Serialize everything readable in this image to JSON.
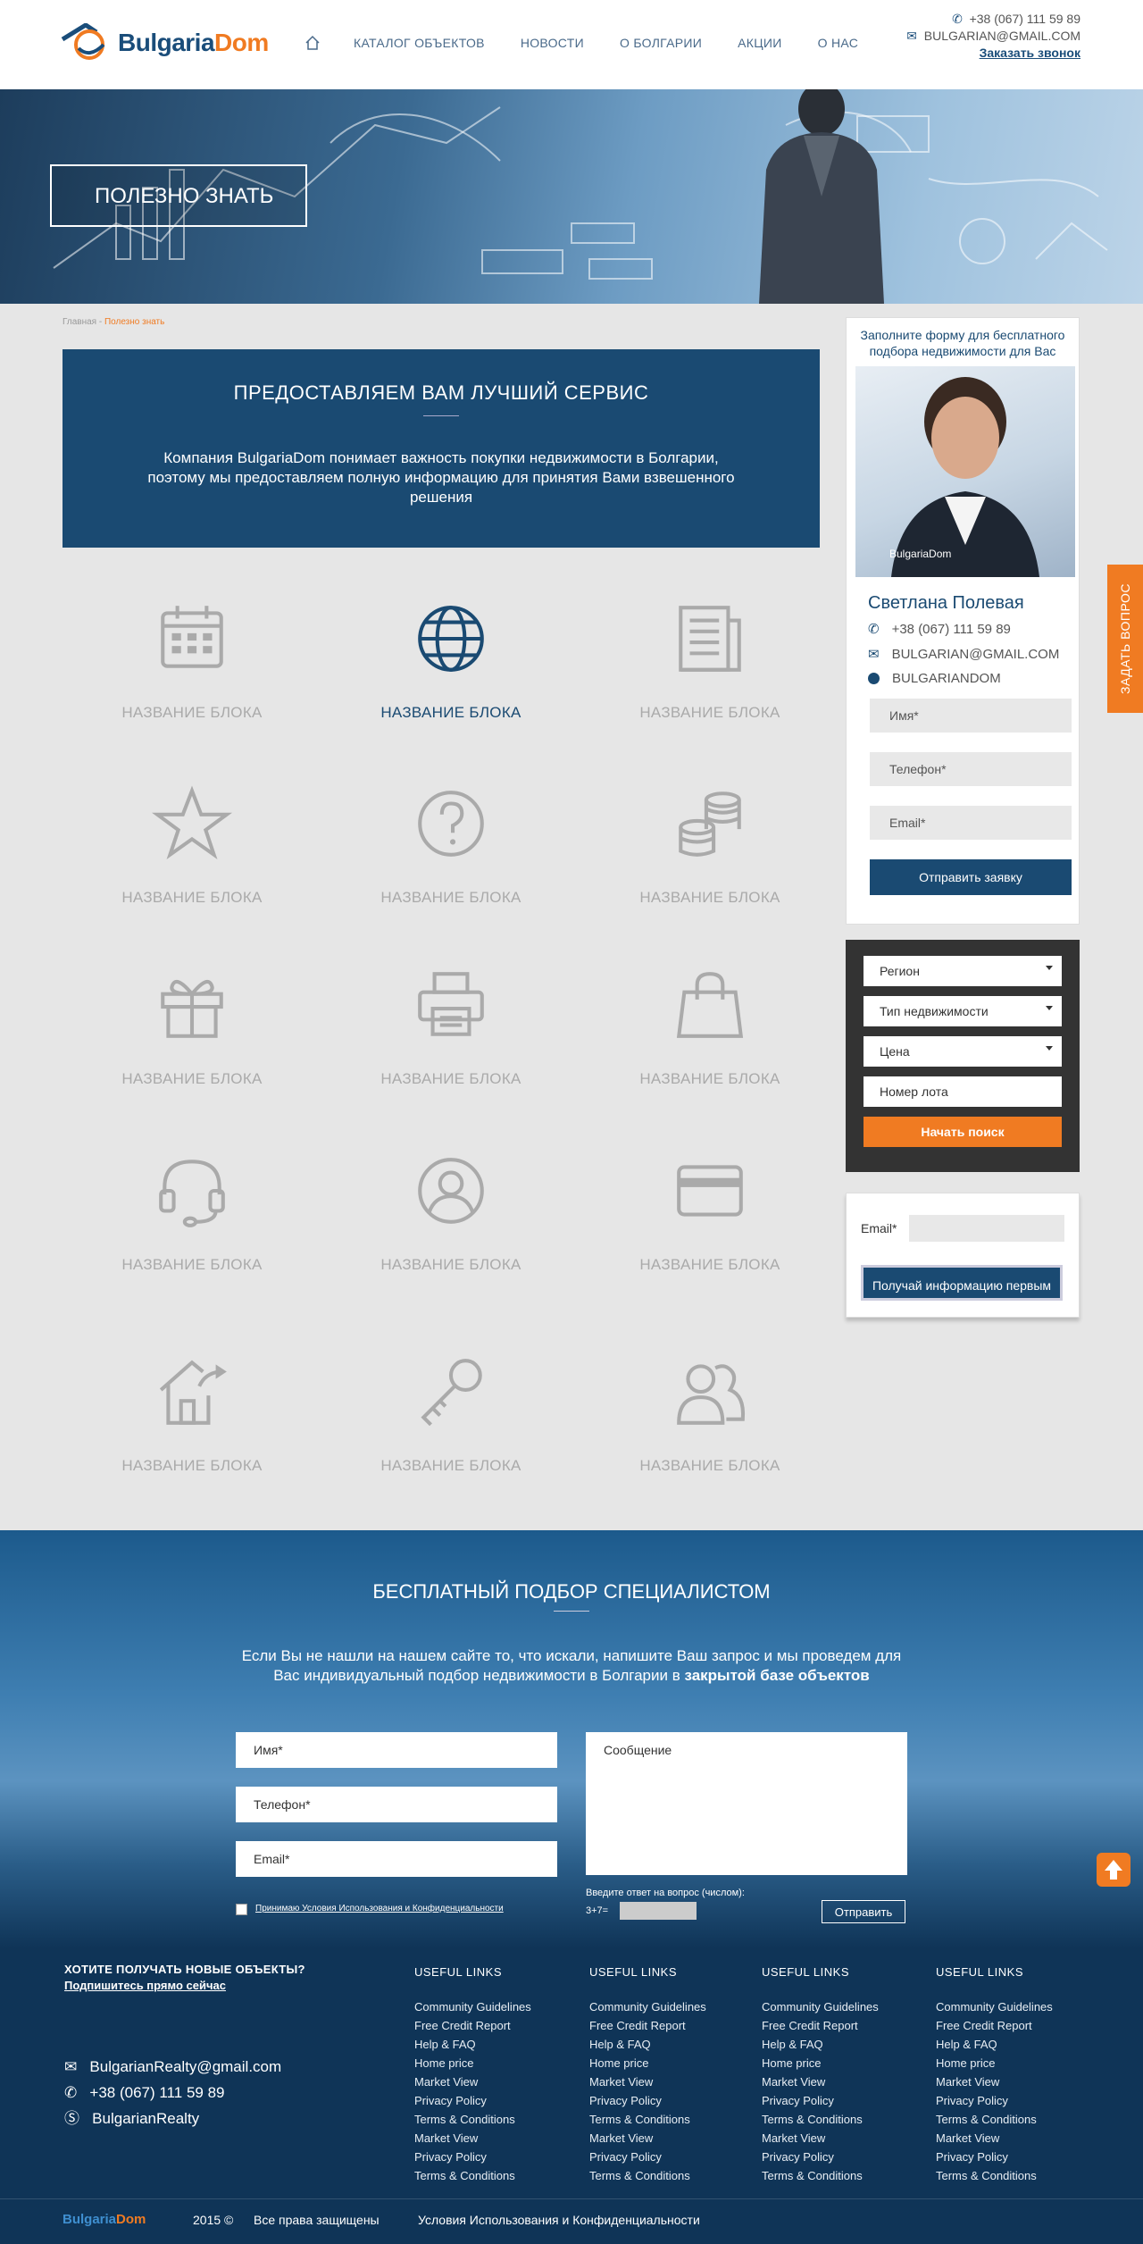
{
  "header": {
    "logo_part1": "Bulgaria",
    "logo_part2": "Dom",
    "nav": [
      "КАТАЛОГ ОБЪЕКТОВ",
      "НОВОСТИ",
      "О БОЛГАРИИ",
      "АКЦИИ",
      "О НАС"
    ],
    "phone": "+38 (067) 111 59 89",
    "email": "BULGARIAN@GMAIL.COM",
    "callback": "Заказать звонок"
  },
  "hero": {
    "title": "ПОЛЕЗНО ЗНАТЬ"
  },
  "breadcrumb": {
    "home": "Главная",
    "sep": " - ",
    "current": "Полезно знать"
  },
  "service": {
    "title": "ПРЕДОСТАВЛЯЕМ ВАМ ЛУЧШИЙ СЕРВИС",
    "text": "Компания BulgariaDom понимает важность покупки недвижимости в Болгарии, поэтому мы предоставляем полную информацию для принятия Вами взвешенного решения"
  },
  "blocks": [
    {
      "icon": "calendar-icon",
      "label": "НАЗВАНИЕ БЛОКА"
    },
    {
      "icon": "globe-icon",
      "label": "НАЗВАНИЕ БЛОКА"
    },
    {
      "icon": "newspaper-icon",
      "label": "НАЗВАНИЕ БЛОКА"
    },
    {
      "icon": "star-icon",
      "label": "НАЗВАНИЕ БЛОКА"
    },
    {
      "icon": "question-icon",
      "label": "НАЗВАНИЕ БЛОКА"
    },
    {
      "icon": "coins-icon",
      "label": "НАЗВАНИЕ БЛОКА"
    },
    {
      "icon": "gift-icon",
      "label": "НАЗВАНИЕ БЛОКА"
    },
    {
      "icon": "printer-icon",
      "label": "НАЗВАНИЕ БЛОКА"
    },
    {
      "icon": "bag-icon",
      "label": "НАЗВАНИЕ БЛОКА"
    },
    {
      "icon": "headset-icon",
      "label": "НАЗВАНИЕ БЛОКА"
    },
    {
      "icon": "user-icon",
      "label": "НАЗВАНИЕ БЛОКА"
    },
    {
      "icon": "card-icon",
      "label": "НАЗВАНИЕ БЛОКА"
    },
    {
      "icon": "house-icon",
      "label": "НАЗВАНИЕ БЛОКА"
    },
    {
      "icon": "key-icon",
      "label": "НАЗВАНИЕ БЛОКА"
    },
    {
      "icon": "users-icon",
      "label": "НАЗВАНИЕ БЛОКА"
    }
  ],
  "agent": {
    "heading": "Заполните форму для бесплатного подбора недвижимости для Вас",
    "watermark": "BulgariaDom",
    "name": "Светлана Полевая",
    "phone": "+38 (067) 111 59 89",
    "email": "BULGARIAN@GMAIL.COM",
    "skype": "BULGARIANDOM",
    "field_name": "Имя*",
    "field_phone": "Телефон*",
    "field_email": "Email*",
    "submit": "Отправить заявку"
  },
  "search": {
    "region": "Регион",
    "type": "Тип недвижимости",
    "price": "Цена",
    "lot": "Номер лота",
    "submit": "Начать поиск"
  },
  "subscribe": {
    "label": "Email*",
    "button": "Получай информацию первым"
  },
  "ask_tab": "ЗАДАТЬ ВОПРОС",
  "pick": {
    "title": "БЕСПЛАТНЫЙ ПОДБОР СПЕЦИАЛИСТОМ",
    "text1": "Если Вы не нашли на нашем сайте то, что искали, напишите Ваш запрос и мы проведем для Вас индивидуальный подбор недвижимости в Болгарии в ",
    "text_bold": "закрытой базе объектов",
    "name": "Имя*",
    "phone": "Телефон*",
    "email": "Email*",
    "message": "Сообщение",
    "captcha_label": "Введите ответ на вопрос (числом):",
    "captcha_q": "3+7=",
    "agree": "Принимаю Условия Использования и Конфиденциальности",
    "send": "Отправить"
  },
  "footer": {
    "promo": "ХОТИТЕ ПОЛУЧАТЬ НОВЫЕ ОБЪЕКТЫ?",
    "promo_link": "Подпишитесь прямо сейчас",
    "email": "BulgarianRealty@gmail.com",
    "phone": "+38 (067) 111 59 89",
    "skype": "BulgarianRealty",
    "col_title": "USEFUL LINKS",
    "links": [
      "Community Guidelines",
      "Free Credit Report",
      "Help & FAQ",
      "Home price",
      "Market View",
      "Privacy Policy",
      "Terms & Conditions",
      "Market View",
      "Privacy Policy",
      "Terms & Conditions"
    ],
    "year": "2015 ©",
    "rights": "Все права защищены",
    "terms": "Условия Использования и Конфиденциальности"
  },
  "colors": {
    "brand_blue": "#1a4a72",
    "accent_orange": "#f07b22"
  }
}
